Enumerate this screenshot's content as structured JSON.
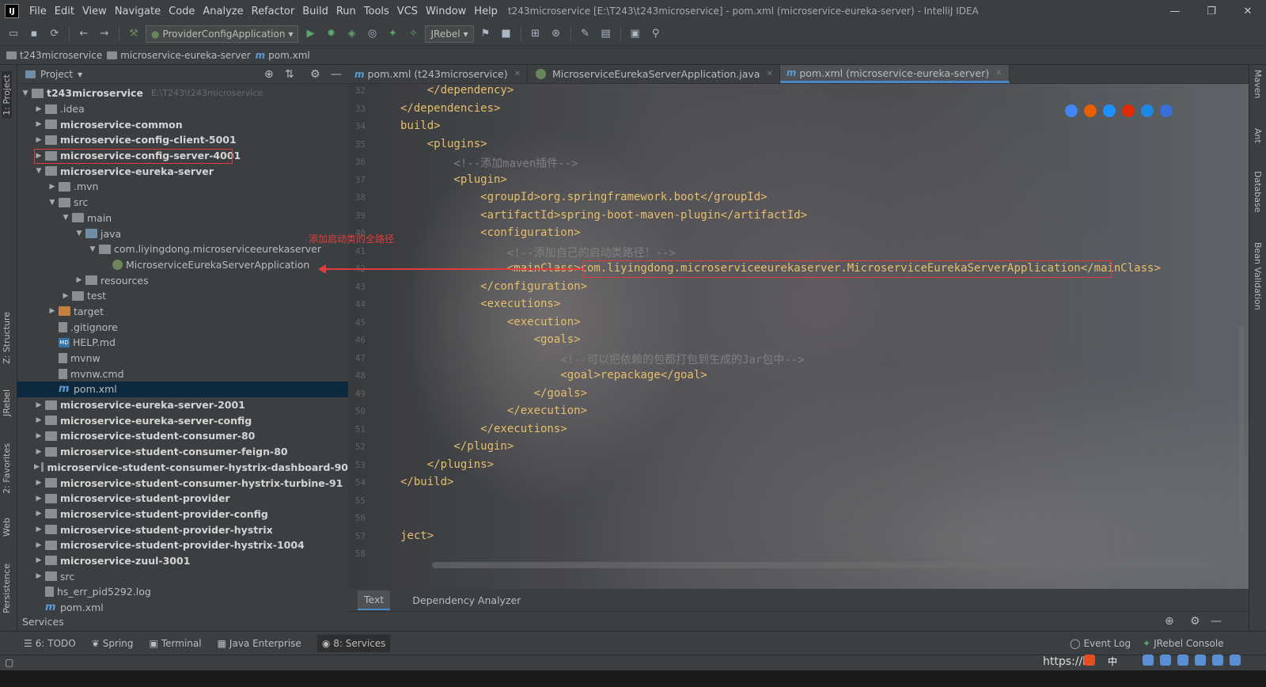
{
  "window": {
    "title": "t243microservice [E:\\T243\\t243microservice] - pom.xml (microservice-eureka-server) - IntelliJ IDEA",
    "logo": "IJ",
    "minimize_icon": "—",
    "restore_icon": "❐",
    "close_icon": "✕"
  },
  "menu": [
    "File",
    "Edit",
    "View",
    "Navigate",
    "Code",
    "Analyze",
    "Refactor",
    "Build",
    "Run",
    "Tools",
    "VCS",
    "Window",
    "Help"
  ],
  "toolbar": {
    "run_config": "ProviderConfigApplication",
    "jrebel": "JRebel"
  },
  "breadcrumb": [
    "t243microservice",
    "microservice-eureka-server",
    "pom.xml"
  ],
  "left_stripe": {
    "project_tab": "1: Project",
    "structure_tab": "Z: Structure",
    "jrebel_tab": "JRebel",
    "favorites_tab": "2: Favorites",
    "web_tab": "Web",
    "persistence_tab": "Persistence"
  },
  "right_stripe": {
    "maven_tab": "Maven",
    "ant_tab": "Ant",
    "database_tab": "Database",
    "bean_validation_tab": "Bean Validation"
  },
  "project_panel": {
    "title": "Project",
    "root": "t243microservice",
    "root_path": "E:\\T243\\t243microservice",
    "items": [
      {
        "label": ".idea",
        "depth": 1,
        "bold": false,
        "icon": "folder",
        "arrow": "▶"
      },
      {
        "label": "microservice-common",
        "depth": 1,
        "bold": true,
        "icon": "folder",
        "arrow": "▶"
      },
      {
        "label": "microservice-config-client-5001",
        "depth": 1,
        "bold": true,
        "icon": "folder",
        "arrow": "▶"
      },
      {
        "label": "microservice-config-server-4001",
        "depth": 1,
        "bold": true,
        "icon": "folder",
        "arrow": "▶"
      },
      {
        "label": "microservice-eureka-server",
        "depth": 1,
        "bold": true,
        "icon": "folder",
        "arrow": "▼"
      },
      {
        "label": ".mvn",
        "depth": 2,
        "bold": false,
        "icon": "folder",
        "arrow": "▶"
      },
      {
        "label": "src",
        "depth": 2,
        "bold": false,
        "icon": "folder",
        "arrow": "▼"
      },
      {
        "label": "main",
        "depth": 3,
        "bold": false,
        "icon": "folder",
        "arrow": "▼"
      },
      {
        "label": "java",
        "depth": 4,
        "bold": false,
        "icon": "folder-blue",
        "arrow": "▼"
      },
      {
        "label": "com.liyingdong.microserviceeurekaserver",
        "depth": 5,
        "bold": false,
        "icon": "folder",
        "arrow": "▼"
      },
      {
        "label": "MicroserviceEurekaServerApplication",
        "depth": 6,
        "bold": false,
        "icon": "spring",
        "arrow": ""
      },
      {
        "label": "resources",
        "depth": 4,
        "bold": false,
        "icon": "folder",
        "arrow": "▶"
      },
      {
        "label": "test",
        "depth": 3,
        "bold": false,
        "icon": "folder",
        "arrow": "▶"
      },
      {
        "label": "target",
        "depth": 2,
        "bold": false,
        "icon": "folder-orange",
        "arrow": "▶"
      },
      {
        "label": ".gitignore",
        "depth": 2,
        "bold": false,
        "icon": "file",
        "arrow": ""
      },
      {
        "label": "HELP.md",
        "depth": 2,
        "bold": false,
        "icon": "md",
        "arrow": ""
      },
      {
        "label": "mvnw",
        "depth": 2,
        "bold": false,
        "icon": "file",
        "arrow": ""
      },
      {
        "label": "mvnw.cmd",
        "depth": 2,
        "bold": false,
        "icon": "file",
        "arrow": ""
      },
      {
        "label": "pom.xml",
        "depth": 2,
        "bold": false,
        "icon": "m",
        "arrow": "",
        "selected": true
      },
      {
        "label": "microservice-eureka-server-2001",
        "depth": 1,
        "bold": true,
        "icon": "folder",
        "arrow": "▶"
      },
      {
        "label": "microservice-eureka-server-config",
        "depth": 1,
        "bold": true,
        "icon": "folder",
        "arrow": "▶"
      },
      {
        "label": "microservice-student-consumer-80",
        "depth": 1,
        "bold": true,
        "icon": "folder",
        "arrow": "▶"
      },
      {
        "label": "microservice-student-consumer-feign-80",
        "depth": 1,
        "bold": true,
        "icon": "folder",
        "arrow": "▶"
      },
      {
        "label": "microservice-student-consumer-hystrix-dashboard-90",
        "depth": 1,
        "bold": true,
        "icon": "folder",
        "arrow": "▶"
      },
      {
        "label": "microservice-student-consumer-hystrix-turbine-91",
        "depth": 1,
        "bold": true,
        "icon": "folder",
        "arrow": "▶"
      },
      {
        "label": "microservice-student-provider",
        "depth": 1,
        "bold": true,
        "icon": "folder",
        "arrow": "▶"
      },
      {
        "label": "microservice-student-provider-config",
        "depth": 1,
        "bold": true,
        "icon": "folder",
        "arrow": "▶"
      },
      {
        "label": "microservice-student-provider-hystrix",
        "depth": 1,
        "bold": true,
        "icon": "folder",
        "arrow": "▶"
      },
      {
        "label": "microservice-student-provider-hystrix-1004",
        "depth": 1,
        "bold": true,
        "icon": "folder",
        "arrow": "▶"
      },
      {
        "label": "microservice-zuul-3001",
        "depth": 1,
        "bold": true,
        "icon": "folder",
        "arrow": "▶"
      },
      {
        "label": "src",
        "depth": 1,
        "bold": false,
        "icon": "folder",
        "arrow": "▶"
      },
      {
        "label": "hs_err_pid5292.log",
        "depth": 1,
        "bold": false,
        "icon": "file",
        "arrow": ""
      },
      {
        "label": "pom.xml",
        "depth": 1,
        "bold": false,
        "icon": "m",
        "arrow": ""
      }
    ],
    "services_label": "Services"
  },
  "annotation": {
    "text": "添加启动类的全路径",
    "color": "#e23b3b"
  },
  "editor": {
    "tabs": [
      {
        "label": "pom.xml (t243microservice)",
        "icon": "m",
        "active": false
      },
      {
        "label": "MicroserviceEurekaServerApplication.java",
        "icon": "spring",
        "active": false
      },
      {
        "label": "pom.xml (microservice-eureka-server)",
        "icon": "m",
        "active": true
      }
    ],
    "line_numbers": [
      "32",
      "33",
      "34",
      "35",
      "36",
      "37",
      "38",
      "39",
      "40",
      "41",
      "42",
      "43",
      "44",
      "45",
      "46",
      "47",
      "48",
      "49",
      "50",
      "51",
      "52",
      "53",
      "54",
      "55",
      "56",
      "57",
      "58"
    ],
    "lines": [
      {
        "text": "    </dependency>",
        "kind": "tag"
      },
      {
        "text": "</dependencies>",
        "kind": "tag"
      },
      {
        "text": "build>",
        "kind": "tag"
      },
      {
        "text": "    <plugins>",
        "kind": "tag"
      },
      {
        "text": "        <!--添加maven插件-->",
        "kind": "comment"
      },
      {
        "text": "        <plugin>",
        "kind": "tag"
      },
      {
        "text": "            <groupId>org.springframework.boot</groupId>",
        "kind": "tag"
      },
      {
        "text": "            <artifactId>spring-boot-maven-plugin</artifactId>",
        "kind": "tag"
      },
      {
        "text": "            <configuration>",
        "kind": "tag"
      },
      {
        "text": "                <!--添加自己的启动类路径！-->",
        "kind": "comment"
      },
      {
        "text": "                <mainClass>com.liyingdong.microserviceeurekaserver.MicroserviceEurekaServerApplication</mainClass>",
        "kind": "tag"
      },
      {
        "text": "            </configuration>",
        "kind": "tag"
      },
      {
        "text": "            <executions>",
        "kind": "tag"
      },
      {
        "text": "                <execution>",
        "kind": "tag"
      },
      {
        "text": "                    <goals>",
        "kind": "tag"
      },
      {
        "text": "                        <!--可以把依赖的包都打包到生成的Jar包中-->",
        "kind": "comment"
      },
      {
        "text": "                        <goal>repackage</goal>",
        "kind": "tag"
      },
      {
        "text": "                    </goals>",
        "kind": "tag"
      },
      {
        "text": "                </execution>",
        "kind": "tag"
      },
      {
        "text": "            </executions>",
        "kind": "tag"
      },
      {
        "text": "        </plugin>",
        "kind": "tag"
      },
      {
        "text": "    </plugins>",
        "kind": "tag"
      },
      {
        "text": "</build>",
        "kind": "tag"
      },
      {
        "text": "",
        "kind": "tag"
      },
      {
        "text": "",
        "kind": "tag"
      },
      {
        "text": "ject>",
        "kind": "tag"
      },
      {
        "text": "",
        "kind": "tag"
      }
    ],
    "bottom_tabs": [
      "Text",
      "Dependency Analyzer"
    ],
    "browser_icon_colors": [
      "#4285f4",
      "#e66000",
      "#1e90ff",
      "#dd2c00",
      "#1e88e5",
      "#3a6fd8"
    ]
  },
  "bottom_bar": {
    "items": [
      {
        "label": "6: TODO",
        "icon": "☰"
      },
      {
        "label": "Spring",
        "icon": "❦"
      },
      {
        "label": "Terminal",
        "icon": "▣"
      },
      {
        "label": "Java Enterprise",
        "icon": "▦"
      },
      {
        "label": "8: Services",
        "icon": "◉",
        "active": true
      }
    ],
    "event_log": "Event Log",
    "jrebel_console": "JRebel Console"
  },
  "status": {
    "watermark": "https://b"
  }
}
